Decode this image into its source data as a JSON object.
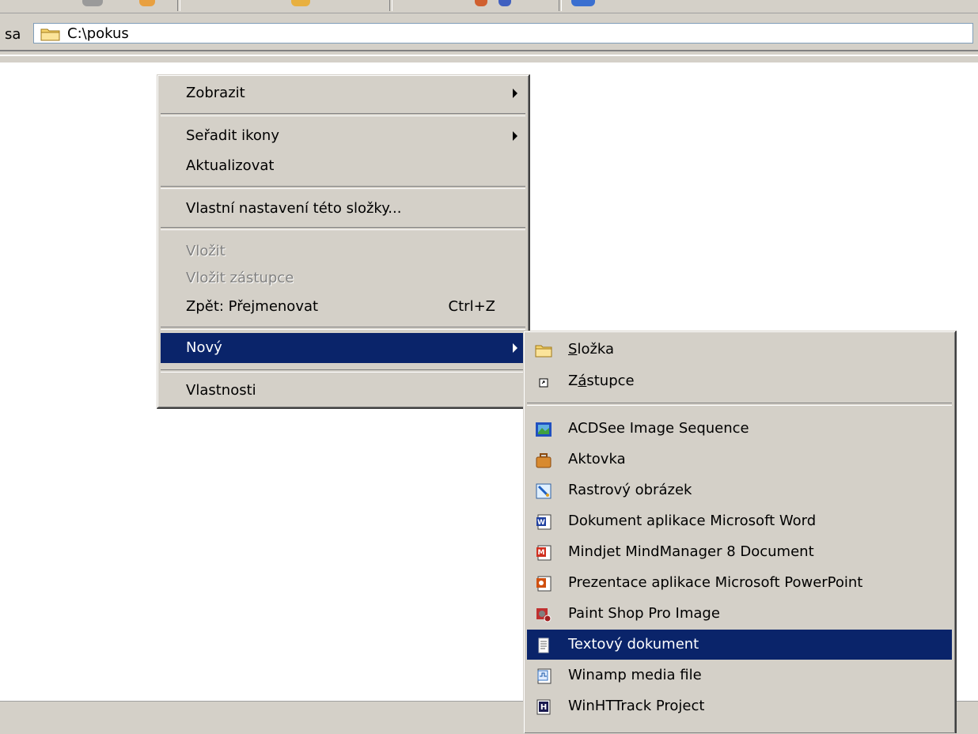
{
  "address_bar": {
    "label": "sa",
    "path": "C:\\pokus"
  },
  "context_menu": {
    "items": [
      {
        "label": "Zobrazit",
        "submenu": true
      },
      {
        "label": "Seřadit ikony",
        "submenu": true
      },
      {
        "label": "Aktualizovat"
      },
      {
        "label": "Vlastní nastavení této složky..."
      },
      {
        "label": "Vložit",
        "disabled": true
      },
      {
        "label": "Vložit zástupce",
        "disabled": true
      },
      {
        "label": "Zpět: Přejmenovat",
        "shortcut": "Ctrl+Z"
      },
      {
        "label": "Nový",
        "submenu": true,
        "selected": true
      },
      {
        "label": "Vlastnosti"
      }
    ]
  },
  "new_submenu": {
    "items": [
      {
        "label_pre": "",
        "label_u": "S",
        "label_post": "ložka",
        "icon": "folder-icon"
      },
      {
        "label_pre": "Z",
        "label_u": "á",
        "label_post": "stupce",
        "icon": "shortcut-icon"
      },
      {
        "label": "ACDSee Image Sequence",
        "icon": "acdsee-icon"
      },
      {
        "label": "Aktovka",
        "icon": "briefcase-icon"
      },
      {
        "label": "Rastrový obrázek",
        "icon": "bitmap-icon"
      },
      {
        "label": "Dokument aplikace Microsoft Word",
        "icon": "word-icon"
      },
      {
        "label": "Mindjet MindManager 8 Document",
        "icon": "mindmanager-icon"
      },
      {
        "label": "Prezentace aplikace Microsoft PowerPoint",
        "icon": "powerpoint-icon"
      },
      {
        "label": "Paint Shop Pro Image",
        "icon": "paintshop-icon"
      },
      {
        "label": "Textový dokument",
        "icon": "text-document-icon",
        "selected": true
      },
      {
        "label": "Winamp media file",
        "icon": "winamp-icon"
      },
      {
        "label": "WinHTTrack Project",
        "icon": "winhttrack-icon"
      }
    ]
  },
  "colors": {
    "selection": "#0a246a",
    "menu_bg": "#d4d0c8",
    "disabled_text": "#808080"
  }
}
